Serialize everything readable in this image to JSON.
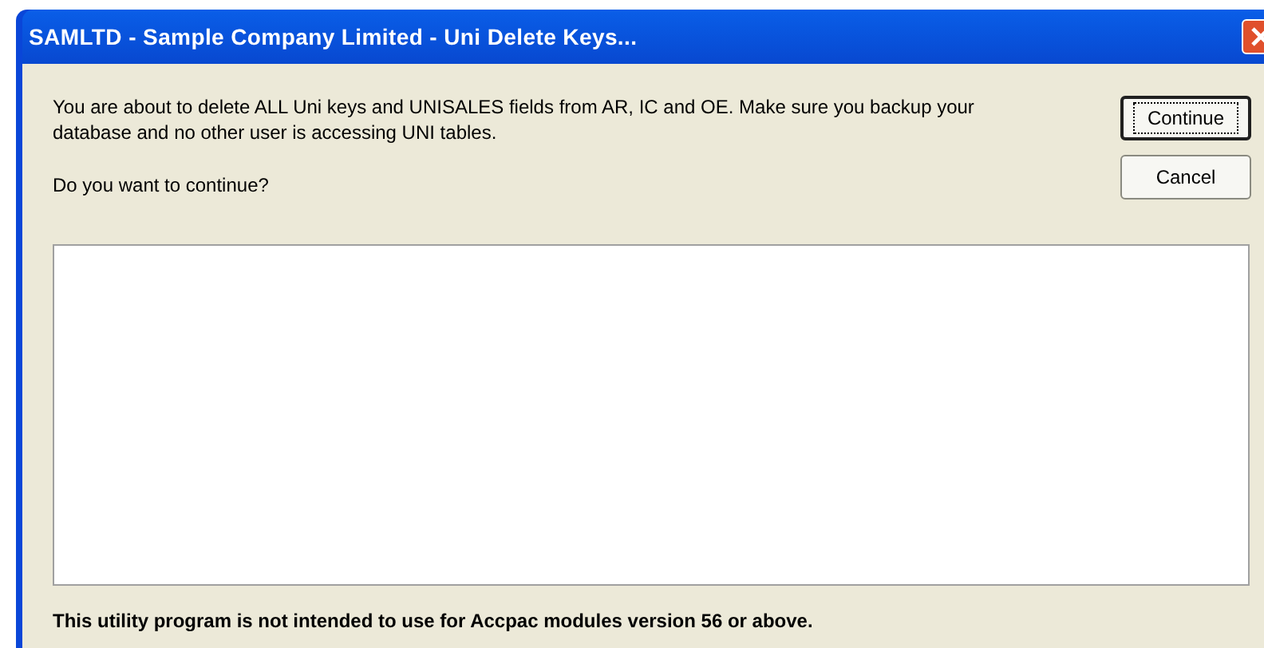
{
  "window": {
    "title": "SAMLTD - Sample Company Limited - Uni Delete Keys..."
  },
  "message": "You are about to delete ALL Uni keys and UNISALES fields from AR, IC and OE. Make sure you backup your database and no other user is accessing UNI tables.",
  "question": "Do you want to continue?",
  "buttons": [
    {
      "label": "Continue",
      "focused": true
    },
    {
      "label": "Cancel",
      "focused": false
    }
  ],
  "footer": "This utility program is not intended to use for Accpac modules version 56 or above."
}
